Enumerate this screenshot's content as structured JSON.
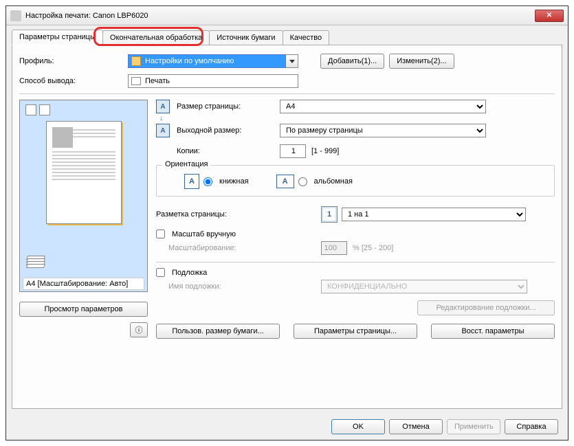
{
  "window": {
    "title": "Настройка печати: Canon LBP6020"
  },
  "tabs": {
    "page_params": "Параметры страницы",
    "finishing": "Окончательная обработка",
    "paper_source": "Источник бумаги",
    "quality": "Качество"
  },
  "profile": {
    "label": "Профиль:",
    "value": "Настройки по умолчанию",
    "add_btn": "Добавить(1)...",
    "edit_btn": "Изменить(2)..."
  },
  "output": {
    "label": "Способ вывода:",
    "value": "Печать"
  },
  "preview": {
    "caption": "A4 [Масштабирование: Авто]",
    "view_params_btn": "Просмотр параметров"
  },
  "page_size": {
    "label": "Размер страницы:",
    "value": "A4"
  },
  "output_size": {
    "label": "Выходной размер:",
    "value": "По размеру страницы"
  },
  "copies": {
    "label": "Копии:",
    "value": "1",
    "range": "[1 - 999]"
  },
  "orientation": {
    "legend": "Ориентация",
    "portrait": "книжная",
    "landscape": "альбомная"
  },
  "layout": {
    "label": "Разметка страницы:",
    "value": "1 на 1"
  },
  "manual_scale": {
    "check": "Масштаб вручную",
    "label": "Масштабирование:",
    "value": "100",
    "range": "% [25 - 200]"
  },
  "watermark": {
    "check": "Подложка",
    "name_label": "Имя подложки:",
    "value": "КОНФИДЕНЦИАЛЬНО",
    "edit_btn": "Редактирование подложки..."
  },
  "bottom_btns": {
    "custom_size": "Пользов. размер бумаги...",
    "page_params": "Параметры страницы...",
    "restore": "Восст. параметры"
  },
  "dlg": {
    "ok": "OK",
    "cancel": "Отмена",
    "apply": "Применить",
    "help": "Справка"
  }
}
